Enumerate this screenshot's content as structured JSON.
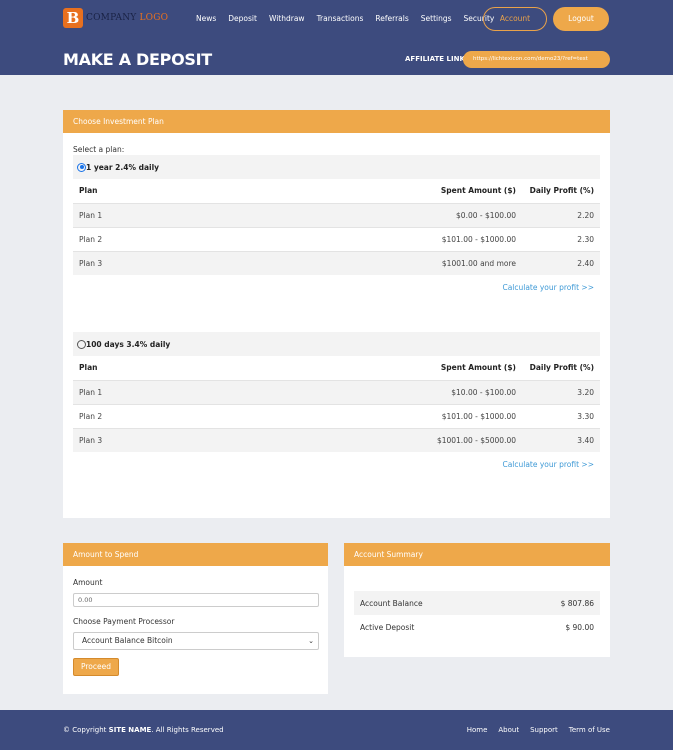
{
  "header": {
    "logo_letter": "B",
    "logo_company": "COMPANY",
    "logo_word": "LOGO",
    "nav": [
      "News",
      "Deposit",
      "Withdraw",
      "Transactions",
      "Referrals",
      "Settings",
      "Security"
    ],
    "account_label": "Account",
    "logout_label": "Logout",
    "page_title": "MAKE A DEPOSIT",
    "affiliate_label": "AFFILIATE LINK:",
    "affiliate_value": "https://lichtexicon.com/demo23/?ref=test"
  },
  "plans_panel": {
    "title": "Choose Investment Plan",
    "select_label": "Select a plan:",
    "columns": [
      "Plan",
      "Spent Amount ($)",
      "Daily Profit (%)"
    ],
    "calc_link": "Calculate your profit >>",
    "plans": [
      {
        "name": "1 year 2.4% daily",
        "selected": true,
        "rows": [
          {
            "plan": "Plan 1",
            "amount": "$0.00 - $100.00",
            "profit": "2.20"
          },
          {
            "plan": "Plan 2",
            "amount": "$101.00 - $1000.00",
            "profit": "2.30"
          },
          {
            "plan": "Plan 3",
            "amount": "$1001.00 and more",
            "profit": "2.40"
          }
        ]
      },
      {
        "name": "100 days 3.4% daily",
        "selected": false,
        "rows": [
          {
            "plan": "Plan 1",
            "amount": "$10.00 - $100.00",
            "profit": "3.20"
          },
          {
            "plan": "Plan 2",
            "amount": "$101.00 - $1000.00",
            "profit": "3.30"
          },
          {
            "plan": "Plan 3",
            "amount": "$1001.00 - $5000.00",
            "profit": "3.40"
          }
        ]
      }
    ]
  },
  "amount_panel": {
    "title": "Amount to Spend",
    "amount_label": "Amount",
    "amount_value": "0.00",
    "processor_label": "Choose Payment Processor",
    "processor_value": "Account Balance Bitcoin",
    "proceed_label": "Proceed"
  },
  "summary_panel": {
    "title": "Account Summary",
    "rows": [
      {
        "label": "Account Balance",
        "value": "$ 807.86"
      },
      {
        "label": "Active Deposit",
        "value": "$ 90.00"
      }
    ]
  },
  "footer": {
    "copy_prefix": "© Copyright",
    "site_name": "SITE NAME",
    "copy_suffix": ". All Rights Reserved",
    "links": [
      "Home",
      "About",
      "Support",
      "Term of Use"
    ]
  },
  "colors": {
    "header_bg": "#3d4b7e",
    "accent": "#eea84a",
    "link": "#3f9ad6"
  }
}
